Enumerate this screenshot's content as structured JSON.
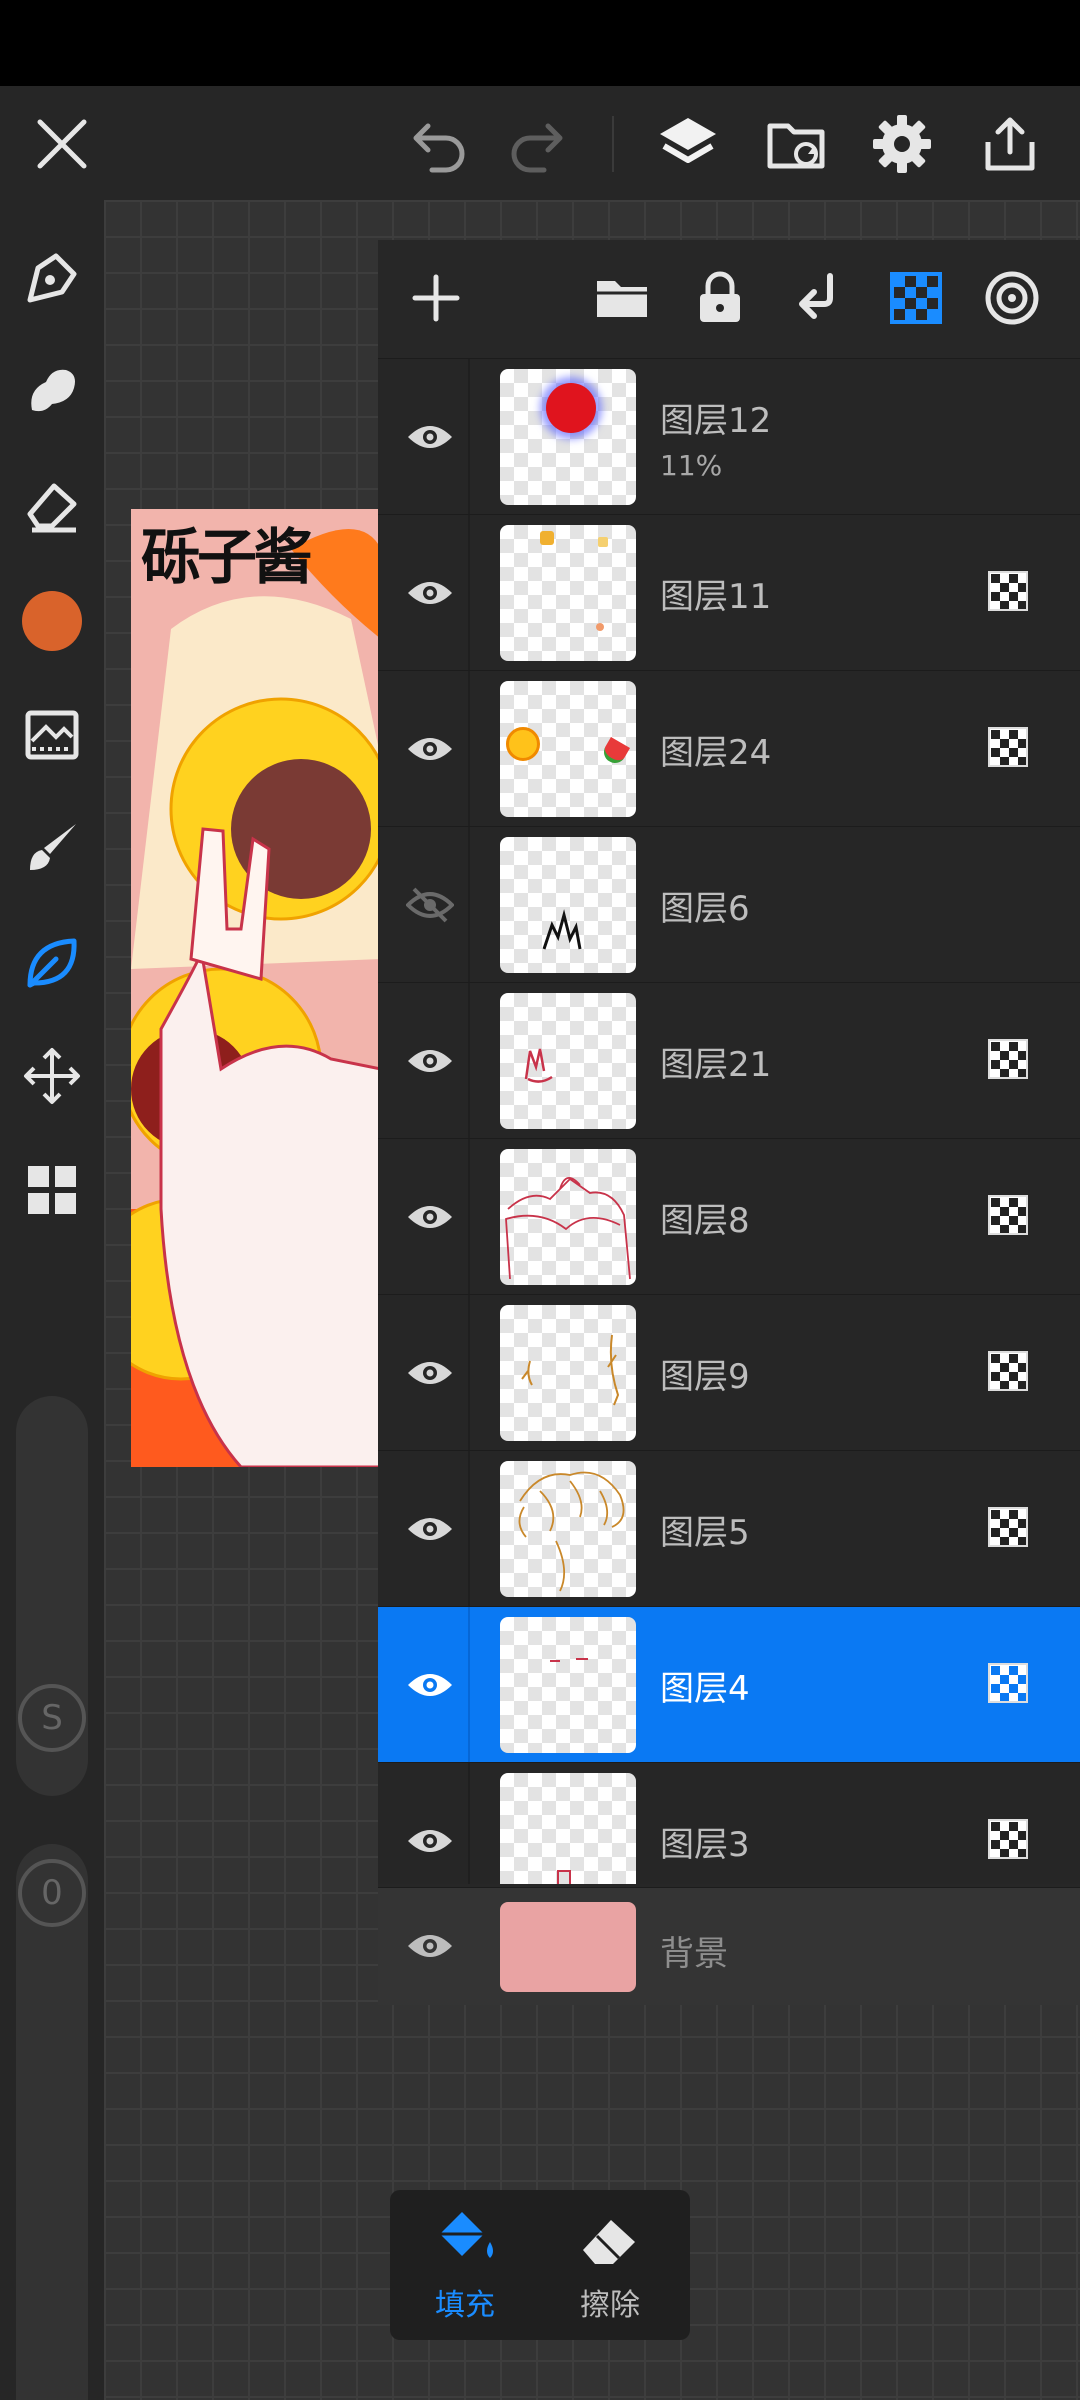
{
  "canvas": {
    "signature_text": "砾子酱"
  },
  "colors": {
    "current_brush_color": "#d9632b",
    "accent": "#0a79f3"
  },
  "layers_panel": {
    "layers": [
      {
        "name": "图层12",
        "opacity": "11%",
        "visible": true
      },
      {
        "name": "图层11",
        "visible": true
      },
      {
        "name": "图层24",
        "visible": true
      },
      {
        "name": "图层6",
        "visible": false
      },
      {
        "name": "图层21",
        "visible": true
      },
      {
        "name": "图层8",
        "visible": true
      },
      {
        "name": "图层9",
        "visible": true
      },
      {
        "name": "图层5",
        "visible": true
      },
      {
        "name": "图层4",
        "visible": true,
        "selected": true
      },
      {
        "name": "图层3",
        "visible": true
      }
    ],
    "background_layer": {
      "name": "背景"
    }
  },
  "side_sliders": {
    "size_label": "S",
    "opacity_label": "0"
  },
  "fill_popup": {
    "fill_label": "填充",
    "erase_label": "擦除"
  }
}
